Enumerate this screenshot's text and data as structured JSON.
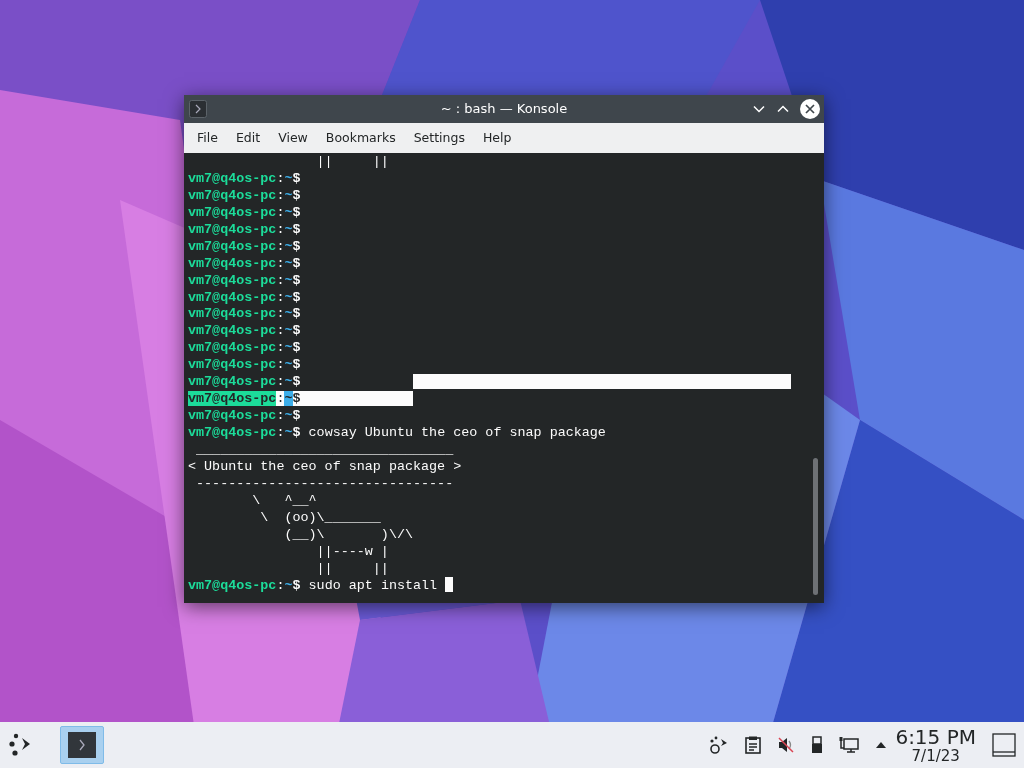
{
  "window": {
    "title": "~ : bash — Konsole"
  },
  "menu": [
    {
      "label": "File"
    },
    {
      "label": "Edit"
    },
    {
      "label": "View"
    },
    {
      "label": "Bookmarks"
    },
    {
      "label": "Settings"
    },
    {
      "label": "Help"
    }
  ],
  "terminal": {
    "lines": [
      {
        "kind": "output",
        "text": "                ||     ||"
      },
      {
        "kind": "prompt",
        "user": "vm7@q4os-pc",
        "sep": ":",
        "path": "~",
        "sign": "$",
        "selected": false
      },
      {
        "kind": "prompt",
        "user": "vm7@q4os-pc",
        "sep": ":",
        "path": "~",
        "sign": "$",
        "selected": false
      },
      {
        "kind": "prompt",
        "user": "vm7@q4os-pc",
        "sep": ":",
        "path": "~",
        "sign": "$",
        "selected": false
      },
      {
        "kind": "prompt",
        "user": "vm7@q4os-pc",
        "sep": ":",
        "path": "~",
        "sign": "$",
        "selected": false
      },
      {
        "kind": "prompt",
        "user": "vm7@q4os-pc",
        "sep": ":",
        "path": "~",
        "sign": "$",
        "selected": false
      },
      {
        "kind": "prompt",
        "user": "vm7@q4os-pc",
        "sep": ":",
        "path": "~",
        "sign": "$",
        "selected": false
      },
      {
        "kind": "prompt",
        "user": "vm7@q4os-pc",
        "sep": ":",
        "path": "~",
        "sign": "$",
        "selected": false
      },
      {
        "kind": "prompt",
        "user": "vm7@q4os-pc",
        "sep": ":",
        "path": "~",
        "sign": "$",
        "selected": false
      },
      {
        "kind": "prompt",
        "user": "vm7@q4os-pc",
        "sep": ":",
        "path": "~",
        "sign": "$",
        "selected": false
      },
      {
        "kind": "prompt",
        "user": "vm7@q4os-pc",
        "sep": ":",
        "path": "~",
        "sign": "$",
        "selected": false
      },
      {
        "kind": "prompt",
        "user": "vm7@q4os-pc",
        "sep": ":",
        "path": "~",
        "sign": "$",
        "selected": false
      },
      {
        "kind": "prompt",
        "user": "vm7@q4os-pc",
        "sep": ":",
        "path": "~",
        "sign": "$",
        "selected": false
      },
      {
        "kind": "prompt",
        "user": "vm7@q4os-pc",
        "sep": ":",
        "path": "~",
        "sign": "$",
        "selected": true
      },
      {
        "kind": "prompt",
        "user": "vm7@q4os-pc",
        "sep": ":",
        "path": "~",
        "sign": "$",
        "selected": true
      },
      {
        "kind": "prompt",
        "user": "vm7@q4os-pc",
        "sep": ":",
        "path": "~",
        "sign": "$",
        "selected": false
      },
      {
        "kind": "prompt",
        "user": "vm7@q4os-pc",
        "sep": ":",
        "path": "~",
        "sign": "$",
        "command": "cowsay Ubuntu the ceo of snap package",
        "selected": false
      },
      {
        "kind": "output",
        "text": " ________________________________"
      },
      {
        "kind": "output",
        "text": "< Ubuntu the ceo of snap package >"
      },
      {
        "kind": "output",
        "text": " --------------------------------"
      },
      {
        "kind": "output",
        "text": "        \\   ^__^"
      },
      {
        "kind": "output",
        "text": "         \\  (oo)\\_______"
      },
      {
        "kind": "output",
        "text": "            (__)\\       )\\/\\"
      },
      {
        "kind": "output",
        "text": "                ||----w |"
      },
      {
        "kind": "output",
        "text": "                ||     ||"
      },
      {
        "kind": "prompt",
        "user": "vm7@q4os-pc",
        "sep": ":",
        "path": "~",
        "sign": "$",
        "command": "sudo apt install",
        "cursor": true,
        "selected": false
      }
    ]
  },
  "taskbar": {
    "tasks": [
      {
        "selected": true
      }
    ],
    "clock": {
      "time": "6:15 PM",
      "date": "7/1/23"
    }
  }
}
